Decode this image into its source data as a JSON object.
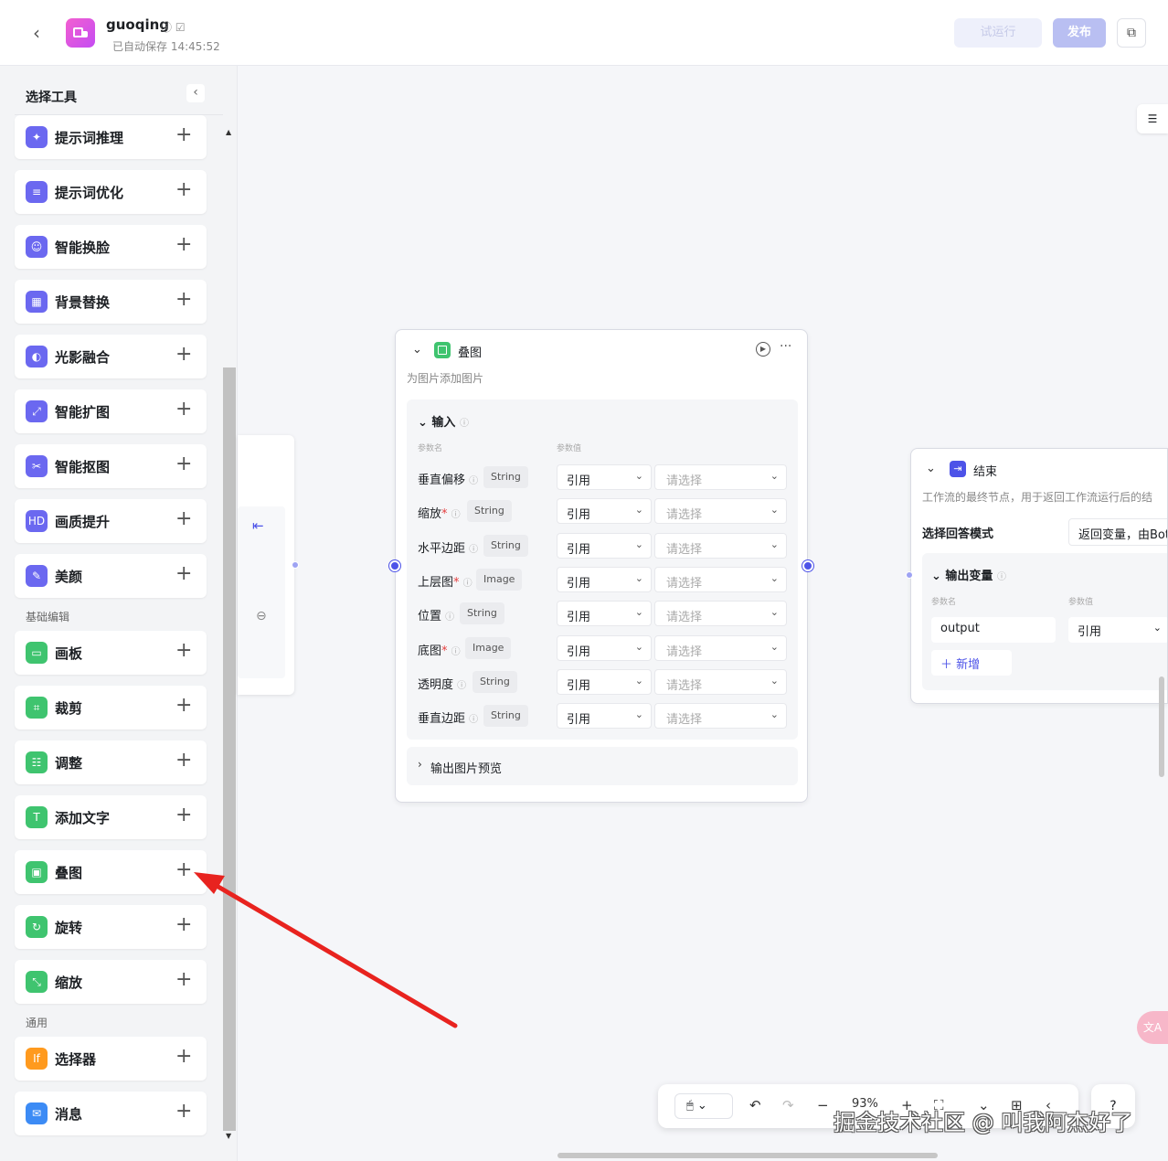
{
  "header": {
    "app_name": "guoqing",
    "meta_icons": "ⓘ ☑",
    "autosave": "已自动保存 14:45:52",
    "test_run": "试运行",
    "publish": "发布"
  },
  "sidebar": {
    "title": "选择工具",
    "tools_ai": [
      {
        "label": "提示词推理",
        "icon": "bulb-icon"
      },
      {
        "label": "提示词优化",
        "icon": "list-icon"
      },
      {
        "label": "智能换脸",
        "icon": "face-icon"
      },
      {
        "label": "背景替换",
        "icon": "background-icon"
      },
      {
        "label": "光影融合",
        "icon": "light-icon"
      },
      {
        "label": "智能扩图",
        "icon": "expand-icon"
      },
      {
        "label": "智能抠图",
        "icon": "cutout-icon"
      },
      {
        "label": "画质提升",
        "icon": "hd-icon"
      },
      {
        "label": "美颜",
        "icon": "beauty-icon"
      }
    ],
    "section_basic": "基础编辑",
    "tools_basic": [
      {
        "label": "画板",
        "icon": "canvas-icon"
      },
      {
        "label": "裁剪",
        "icon": "crop-icon"
      },
      {
        "label": "调整",
        "icon": "adjust-icon"
      },
      {
        "label": "添加文字",
        "icon": "text-icon"
      },
      {
        "label": "叠图",
        "icon": "overlay-icon"
      },
      {
        "label": "旋转",
        "icon": "rotate-icon"
      },
      {
        "label": "缩放",
        "icon": "resize-icon"
      }
    ],
    "section_general": "通用",
    "tools_general": [
      {
        "label": "选择器",
        "icon": "if-icon"
      },
      {
        "label": "消息",
        "icon": "message-icon"
      }
    ]
  },
  "node": {
    "title": "叠图",
    "description": "为图片添加图片",
    "input_title": "输入",
    "col_name": "参数名",
    "col_value": "参数值",
    "ref_label": "引用",
    "placeholder": "请选择",
    "params": [
      {
        "name": "垂直偏移",
        "required": false,
        "type": "String"
      },
      {
        "name": "缩放",
        "required": true,
        "type": "String"
      },
      {
        "name": "水平边距",
        "required": false,
        "type": "String"
      },
      {
        "name": "上层图",
        "required": true,
        "type": "Image"
      },
      {
        "name": "位置",
        "required": false,
        "type": "String"
      },
      {
        "name": "底图",
        "required": true,
        "type": "Image"
      },
      {
        "name": "透明度",
        "required": false,
        "type": "String"
      },
      {
        "name": "垂直边距",
        "required": false,
        "type": "String"
      }
    ],
    "output_title": "输出图片预览"
  },
  "end_node": {
    "title": "结束",
    "description": "工作流的最终节点，用于返回工作流运行后的结",
    "mode_label": "选择回答模式",
    "mode_value": "返回变量，由Bot",
    "output_title": "输出变量",
    "col_name": "参数名",
    "col_value": "参数值",
    "output_name": "output",
    "output_ref": "引用",
    "add_label": "＋ 新增"
  },
  "toolbar": {
    "zoom": "93%"
  },
  "watermark": "掘金技术社区 @ 叫我阿杰好了",
  "colors": {
    "accent": "#4d53e8",
    "ai_tool": "#6b68f0",
    "basic_tool": "#3fc46f",
    "selector": "#ff9a1e",
    "message": "#3c8bf5",
    "arrow": "#e8231f"
  }
}
